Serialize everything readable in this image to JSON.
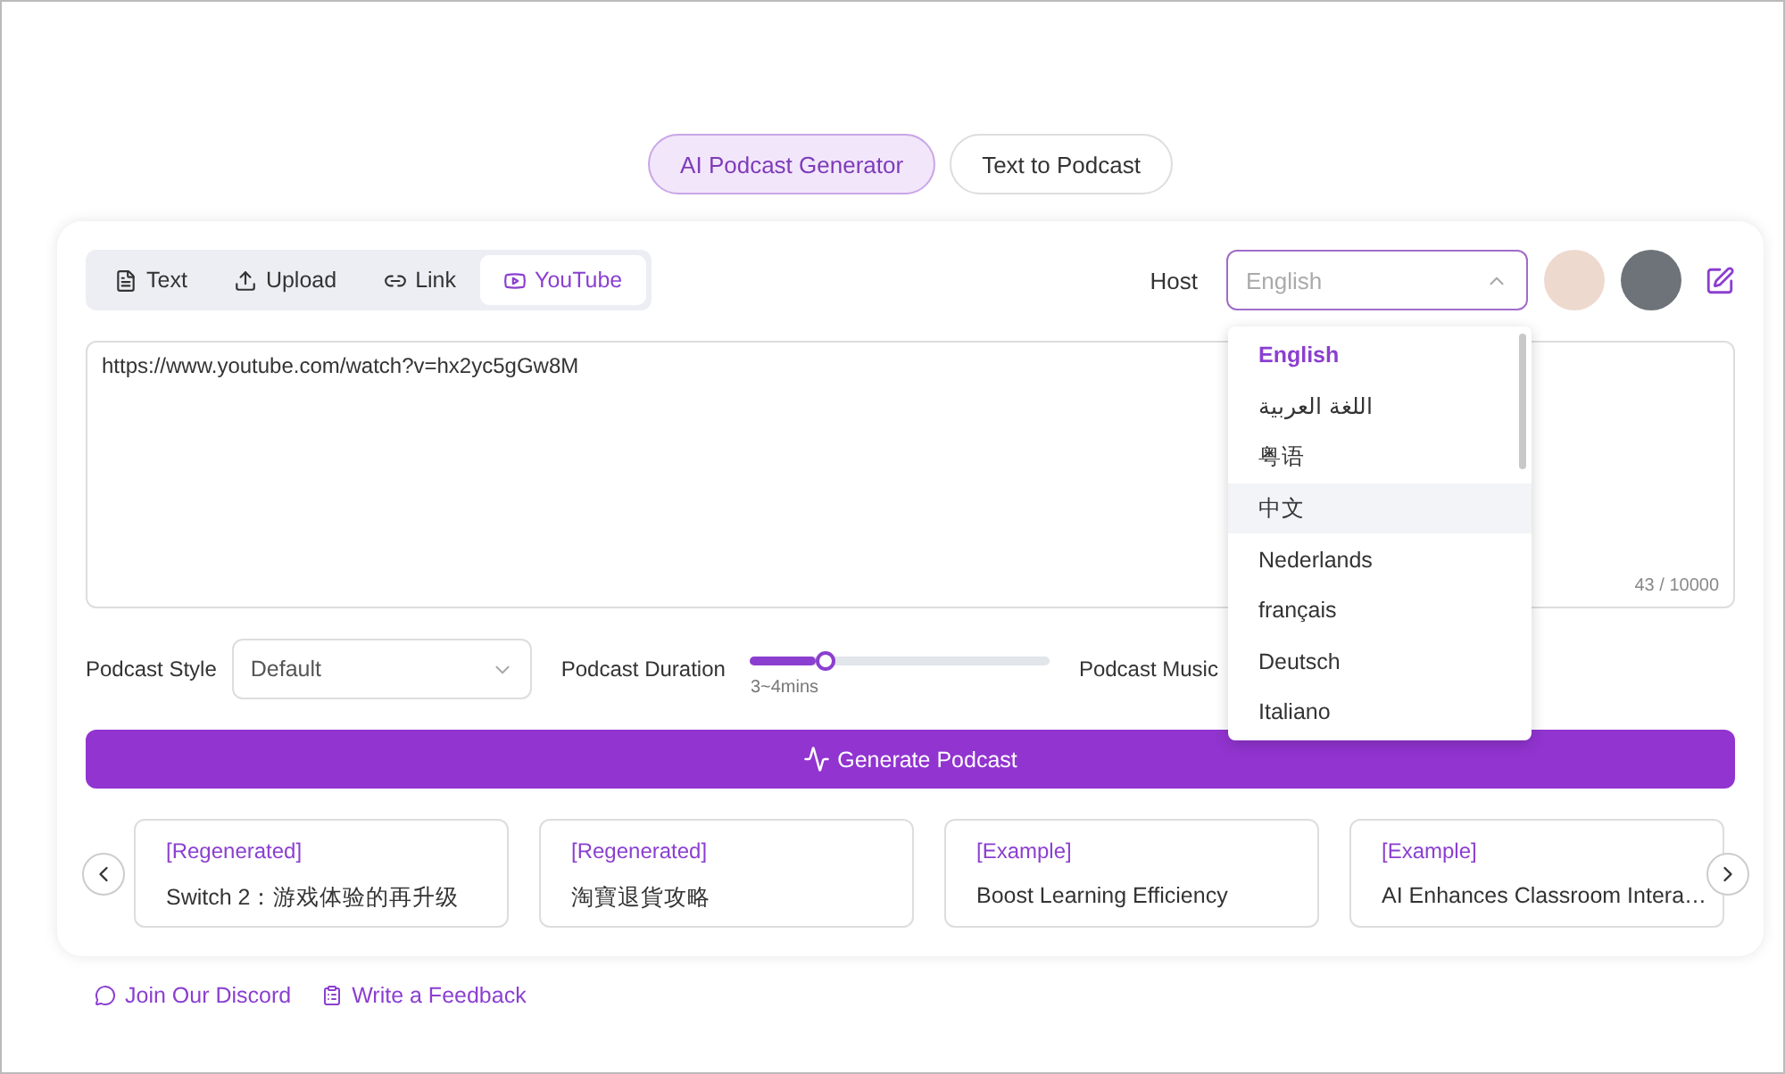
{
  "modes": [
    {
      "label": "AI Podcast Generator",
      "selected": true
    },
    {
      "label": "Text to Podcast",
      "selected": false
    }
  ],
  "source_tabs": [
    {
      "label": "Text",
      "kind": "text",
      "selected": false
    },
    {
      "label": "Upload",
      "kind": "upload",
      "selected": false
    },
    {
      "label": "Link",
      "kind": "link",
      "selected": false
    },
    {
      "label": "YouTube",
      "kind": "youtube",
      "selected": true
    }
  ],
  "host": {
    "label": "Host",
    "placeholder": "English",
    "expanded": true
  },
  "language_options": [
    {
      "label": "English",
      "selected": true,
      "hovered": false
    },
    {
      "label": "اللغة العربية",
      "selected": false,
      "hovered": false
    },
    {
      "label": "粤语",
      "selected": false,
      "hovered": false
    },
    {
      "label": "中文",
      "selected": false,
      "hovered": true
    },
    {
      "label": "Nederlands",
      "selected": false,
      "hovered": false
    },
    {
      "label": "français",
      "selected": false,
      "hovered": false
    },
    {
      "label": "Deutsch",
      "selected": false,
      "hovered": false
    },
    {
      "label": "Italiano",
      "selected": false,
      "hovered": false
    }
  ],
  "input": {
    "value": "https://www.youtube.com/watch?v=hx2yc5gGw8M",
    "counter": "43 / 10000"
  },
  "style": {
    "label": "Podcast Style",
    "value": "Default"
  },
  "duration": {
    "label": "Podcast Duration",
    "level": 0.25,
    "reading": "3~4mins"
  },
  "music": {
    "label": "Podcast Music"
  },
  "generate_button": "Generate Podcast",
  "examples": [
    {
      "tag": "[Regenerated]",
      "title": "Switch 2：游戏体验的再升级"
    },
    {
      "tag": "[Regenerated]",
      "title": "淘寶退貨攻略"
    },
    {
      "tag": "[Example]",
      "title": "Boost Learning Efficiency"
    },
    {
      "tag": "[Example]",
      "title": "AI Enhances Classroom Intera…"
    }
  ],
  "footer_links": [
    {
      "label": "Join Our Discord",
      "kind": "discord"
    },
    {
      "label": "Write a Feedback",
      "kind": "feedback"
    }
  ]
}
